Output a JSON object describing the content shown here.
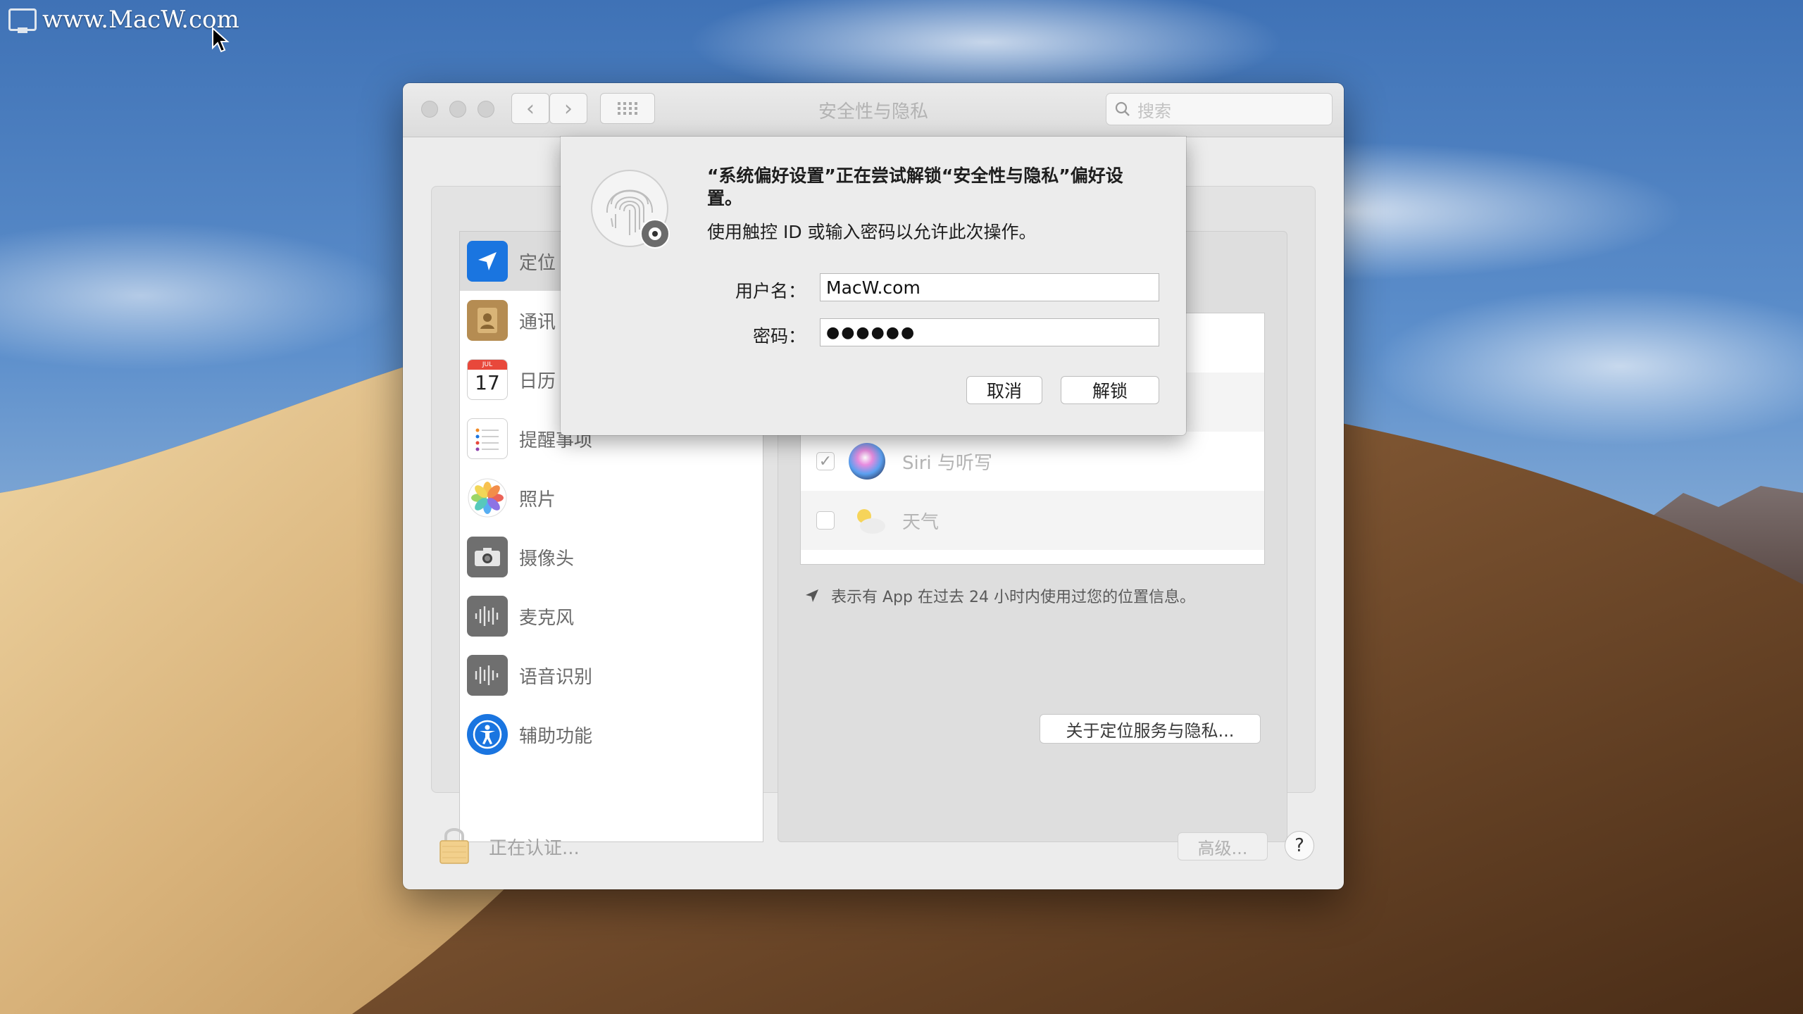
{
  "watermark": {
    "text": "www.MacW.com"
  },
  "window": {
    "title": "安全性与隐私",
    "search_placeholder": "搜索",
    "back_icon": "chevron-left-icon",
    "forward_icon": "chevron-right-icon"
  },
  "sidebar": {
    "items": [
      {
        "label": "定位",
        "icon": "location-arrow-icon",
        "selected": true
      },
      {
        "label": "通讯",
        "icon": "contacts-book-icon"
      },
      {
        "label": "日历",
        "icon": "calendar-icon",
        "calendar_day": "17",
        "calendar_month": "JUL"
      },
      {
        "label": "提醒事项",
        "icon": "reminders-icon"
      },
      {
        "label": "照片",
        "icon": "photos-icon"
      },
      {
        "label": "摄像头",
        "icon": "camera-icon"
      },
      {
        "label": "麦克风",
        "icon": "microphone-icon"
      },
      {
        "label": "语音识别",
        "icon": "speech-recognition-icon"
      },
      {
        "label": "辅助功能",
        "icon": "accessibility-icon"
      }
    ]
  },
  "apps": [
    {
      "name": "Siri 与听写",
      "checked": true,
      "icon": "siri-icon"
    },
    {
      "name": "天气",
      "checked": false,
      "icon": "weather-icon"
    }
  ],
  "location_note": "表示有 App 在过去 24 小时内使用过您的位置信息。",
  "about_button": "关于定位服务与隐私...",
  "footer": {
    "lock_status": "正在认证...",
    "advanced_button": "高级...",
    "help_button": "?"
  },
  "dialog": {
    "title": "“系统偏好设置”正在尝试解锁“安全性与隐私”偏好设置。",
    "message": "使用触控 ID 或输入密码以允许此次操作。",
    "username_label": "用户名：",
    "username_value": "MacW.com",
    "password_label": "密码：",
    "password_value": "●●●●●●",
    "cancel_button": "取消",
    "unlock_button": "解锁"
  },
  "colors": {
    "sky": "#5e90cc",
    "dune_light": "#e8c98f",
    "dune_dark": "#6e4a26",
    "selection": "#dcdcdc"
  }
}
